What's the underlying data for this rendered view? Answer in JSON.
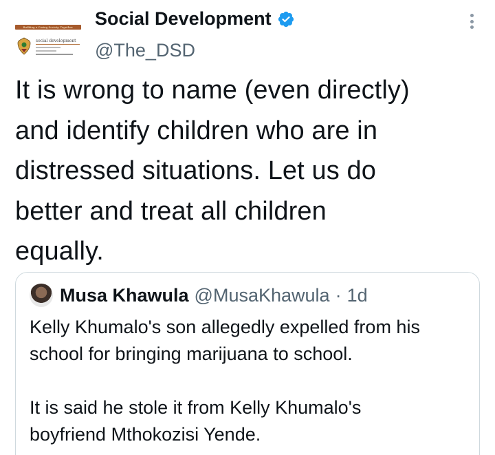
{
  "author": {
    "display_name": "Social Development",
    "handle": "@The_DSD",
    "verified_icon": "verified-badge-icon",
    "verified_color": "#1d9bf0",
    "logo": {
      "banner_text": "Building a Caring Society. Together.",
      "dept_text": "social development"
    }
  },
  "menu": {
    "icon": "more-vertical-icon"
  },
  "tweet": {
    "lines": [
      "It is wrong to name (even directly)",
      "and identify children who are in",
      "distressed situations. Let us do",
      "better and treat all children",
      "equally."
    ]
  },
  "quote": {
    "display_name": "Musa Khawula",
    "handle": "@MusaKhawula",
    "separator": "·",
    "time": "1d",
    "paragraphs": [
      [
        "Kelly Khumalo's son allegedly expelled from his",
        "school for bringing marijuana to school."
      ],
      [
        "It is said he stole it from Kelly Khumalo's",
        "boyfriend Mthokozisi Yende."
      ]
    ]
  },
  "colors": {
    "text_primary": "#0f1419",
    "text_secondary": "#536471",
    "border": "#cfd9de"
  }
}
